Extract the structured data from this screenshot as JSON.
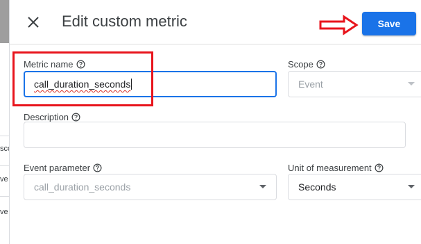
{
  "background": {
    "rows": [
      "sco",
      "ve",
      "ve"
    ]
  },
  "header": {
    "title": "Edit custom metric",
    "save_label": "Save"
  },
  "form": {
    "metric_name": {
      "label": "Metric name",
      "value": "call_duration_seconds"
    },
    "scope": {
      "label": "Scope",
      "value": "Event"
    },
    "description": {
      "label": "Description",
      "value": ""
    },
    "event_parameter": {
      "label": "Event parameter",
      "value": "call_duration_seconds"
    },
    "unit_of_measurement": {
      "label": "Unit of measurement",
      "value": "Seconds"
    }
  },
  "colors": {
    "accent": "#1a73e8",
    "annotation": "#e8141c"
  },
  "icons": {
    "close": "close-icon",
    "help": "help-circle-icon",
    "dropdown": "chevron-down-icon",
    "annotation_arrow": "right-arrow-icon"
  }
}
